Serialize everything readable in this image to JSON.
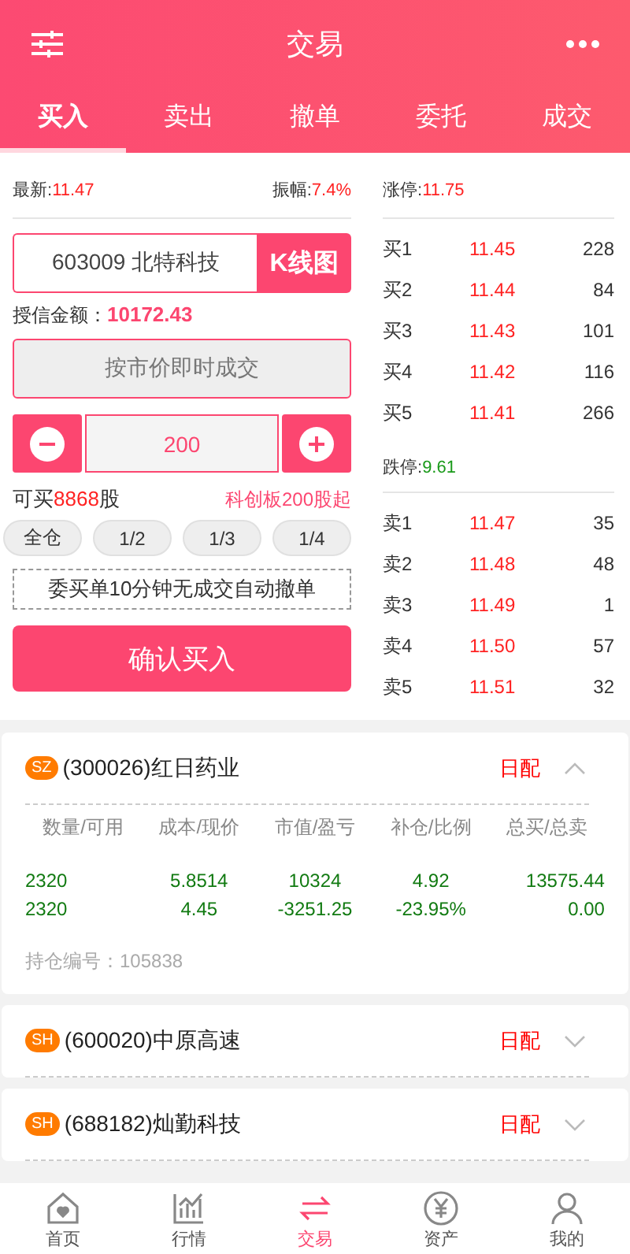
{
  "header": {
    "title": "交易"
  },
  "tabs": [
    {
      "label": "买入",
      "selected": true
    },
    {
      "label": "卖出",
      "selected": false
    },
    {
      "label": "撤单",
      "selected": false
    },
    {
      "label": "委托",
      "selected": false
    },
    {
      "label": "成交",
      "selected": false
    }
  ],
  "quote": {
    "latest_label": "最新:",
    "latest": "11.47",
    "amplitude_label": "振幅:",
    "amplitude": "7.4%",
    "limit_up_label": "涨停:",
    "limit_up": "11.75",
    "limit_down_label": "跌停:",
    "limit_down": "9.61"
  },
  "stock_field": {
    "value": "603009 北特科技",
    "button": "K线图"
  },
  "credit": {
    "label": "授信金额：",
    "value": "10172.43"
  },
  "market_button": "按市价即时成交",
  "quantity": {
    "value": "200"
  },
  "can_buy": {
    "prefix": "可买",
    "amount": "8868",
    "suffix": "股",
    "note": "科创板200股起"
  },
  "ratios": [
    {
      "label": "全仓"
    },
    {
      "label": "1/2"
    },
    {
      "label": "1/3"
    },
    {
      "label": "1/4"
    }
  ],
  "notice": "委买单10分钟无成交自动撤单",
  "confirm_button": "确认买入",
  "bids": [
    {
      "label": "买1",
      "price": "11.45",
      "volume": "228"
    },
    {
      "label": "买2",
      "price": "11.44",
      "volume": "84"
    },
    {
      "label": "买3",
      "price": "11.43",
      "volume": "101"
    },
    {
      "label": "买4",
      "price": "11.42",
      "volume": "116"
    },
    {
      "label": "买5",
      "price": "11.41",
      "volume": "266"
    }
  ],
  "asks": [
    {
      "label": "卖1",
      "price": "11.47",
      "volume": "35"
    },
    {
      "label": "卖2",
      "price": "11.48",
      "volume": "48"
    },
    {
      "label": "卖3",
      "price": "11.49",
      "volume": "1"
    },
    {
      "label": "卖4",
      "price": "11.50",
      "volume": "57"
    },
    {
      "label": "卖5",
      "price": "11.51",
      "volume": "32"
    }
  ],
  "positions": [
    {
      "market": "SZ",
      "name": "(300026)红日药业",
      "tag": "日配",
      "expanded": true,
      "columns": [
        "数量/可用",
        "成本/现价",
        "市值/盈亏",
        "补仓/比例",
        "总买/总卖"
      ],
      "rows": [
        [
          "2320",
          "5.8514",
          "10324",
          "4.92",
          "13575.44"
        ],
        [
          "2320",
          "4.45",
          "-3251.25",
          "-23.95%",
          "0.00"
        ]
      ],
      "holding_label": "持仓编号：",
      "holding_id": "105838"
    },
    {
      "market": "SH",
      "name": "(600020)中原高速",
      "tag": "日配",
      "expanded": false
    },
    {
      "market": "SH",
      "name": "(688182)灿勤科技",
      "tag": "日配",
      "expanded": false
    }
  ],
  "nav": [
    {
      "label": "首页",
      "kind": "home",
      "selected": false
    },
    {
      "label": "行情",
      "kind": "chart",
      "selected": false
    },
    {
      "label": "交易",
      "kind": "swap",
      "selected": true
    },
    {
      "label": "资产",
      "kind": "asset",
      "selected": false
    },
    {
      "label": "我的",
      "kind": "profile",
      "selected": false
    }
  ]
}
